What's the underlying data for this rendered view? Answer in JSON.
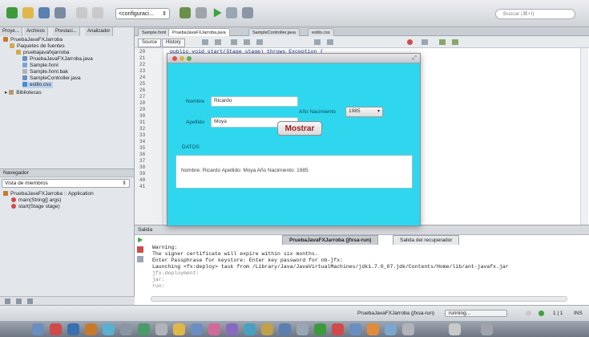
{
  "toolbar": {
    "config_value": "<configuraci...",
    "search_placeholder": "Buscar (⌘+I)"
  },
  "left_panel": {
    "tabs": [
      "Proye...",
      "Archivos",
      "Prestaci...",
      "Analizador"
    ],
    "tree": [
      {
        "label": "PruebaJavaFXJarroba",
        "indent": 0
      },
      {
        "label": "Paquetes de fuentes",
        "indent": 1
      },
      {
        "label": "pruebajavafxjarroba",
        "indent": 2
      },
      {
        "label": "PruebaJavaFXJarroba.java",
        "indent": 3
      },
      {
        "label": "Sample.fxml",
        "indent": 3
      },
      {
        "label": "Sample.fxml.bak",
        "indent": 3
      },
      {
        "label": "SampleController.java",
        "indent": 3
      },
      {
        "label": "estilo.css",
        "indent": 3
      },
      {
        "label": "Bibliotecas",
        "indent": 1
      }
    ],
    "navigator_title": "Navegador",
    "navigator_select": "Vista de miembros",
    "nav_tree": [
      {
        "label": "PruebaJavaFXJarroba :: Application",
        "indent": 0
      },
      {
        "label": "main(String[] args)",
        "indent": 1
      },
      {
        "label": "start(Stage stage)",
        "indent": 1
      }
    ]
  },
  "editor": {
    "tabs": [
      "Sample.fxml",
      "PruebaJavaFXJarroba.java",
      "SampleController.java",
      "estilo.css"
    ],
    "source_label": "Source",
    "history_label": "History",
    "line_numbers": [
      "20",
      "21",
      "22",
      "23",
      "24",
      "25",
      "26",
      "27",
      "28",
      "29",
      "30",
      "31",
      "32",
      "33",
      "34",
      "35",
      "36",
      "37",
      "38",
      "39",
      "40",
      "41"
    ],
    "code_line": "public void start(Stage stage) throws Exception {",
    "closing_brace": "}"
  },
  "dialog": {
    "nombre_label": "Nombre",
    "nombre_value": "Ricardo",
    "apellido_label": "Apellido",
    "apellido_value": "Moya",
    "anio_label": "Año Nacimiento",
    "anio_value": "1985",
    "button_label": "Mostrar",
    "datos_label": "DATOS",
    "result_text": "Nombre: Ricardo Apellido: Moya Año Nacimiento: 1985"
  },
  "output": {
    "title": "Salida",
    "tab_run": "PruebaJavaFXJarroba (jfxsa-run)",
    "tab_recuperador": "Salida del recuperador",
    "lines": [
      "Warning:",
      "The signer certificate will expire within six months.",
      "Enter Passphrase for keystore: Enter key password for nb-jfx:",
      "Launching <fx:deploy> task from /Library/Java/JavaVirtualMachines/jdk1.7.0_07.jdk/Contents/Home/lib/ant-javafx.jar",
      "jfx-deployment:",
      "jar:",
      "run:"
    ]
  },
  "status": {
    "task": "PruebaJavaFXJarroba (jfxsa-run)",
    "state": "running...",
    "position": "1 | 1",
    "mode": "INS"
  },
  "colors": {
    "dialog_bg": "#2fd7ee",
    "button_text": "#a01a1a"
  }
}
